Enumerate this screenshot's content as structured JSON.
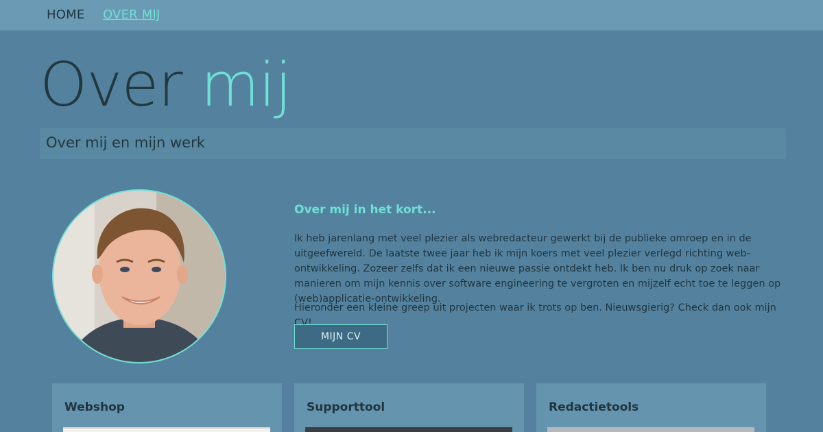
{
  "nav": {
    "home": "HOME",
    "over_mij": "OVER MIJ"
  },
  "hero": {
    "title_part1": "Over",
    "title_part2": "mij",
    "subtitle": "Over mij en mijn werk"
  },
  "intro": {
    "heading": "Over mij in het kort...",
    "paragraph1": "Ik heb jarenlang met veel plezier als webredacteur gewerkt bij de publieke omroep en in de uitgeefwereld. De laatste twee jaar heb ik mijn koers met veel plezier verlegd richting web-ontwikkeling. Zozeer zelfs dat ik een nieuwe passie ontdekt heb. Ik ben nu druk op zoek naar manieren om mijn kennis over software engineering te vergroten en mijzelf echt toe te leggen op (web)applicatie-ontwikkeling.",
    "paragraph2": "Hieronder een kleine greep uit projecten waar ik trots op ben. Nieuwsgierig? Check dan ook mijn CV!",
    "cv_button": "MIJN CV"
  },
  "projects": [
    {
      "title": "Webshop"
    },
    {
      "title": "Supporttool"
    },
    {
      "title": "Redactietools"
    }
  ],
  "colors": {
    "background": "#54829e",
    "navbar": "#6a9ab4",
    "accent": "#6fe0d6",
    "text_dark": "#22383f",
    "card": "#6594ae",
    "button": "#3d6a84"
  }
}
